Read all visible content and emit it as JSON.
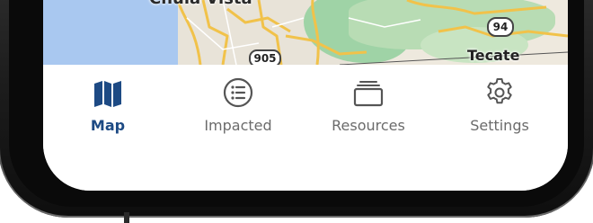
{
  "map": {
    "city_top": "Chula Vista",
    "city_right": "Tecate",
    "route_94": "94",
    "route_905": "905"
  },
  "tabs": [
    {
      "id": "map",
      "label": "Map",
      "icon": "map-icon",
      "active": true
    },
    {
      "id": "impacted",
      "label": "Impacted",
      "icon": "list-icon",
      "active": false
    },
    {
      "id": "resources",
      "label": "Resources",
      "icon": "stack-icon",
      "active": false
    },
    {
      "id": "settings",
      "label": "Settings",
      "icon": "gear-icon",
      "active": false
    }
  ],
  "colors": {
    "active": "#1d4a84",
    "inactive": "#6b6b6b"
  }
}
